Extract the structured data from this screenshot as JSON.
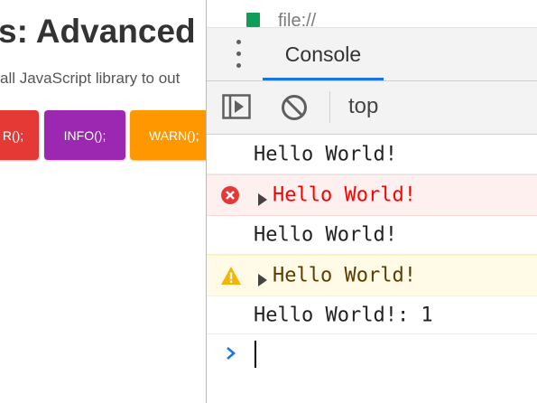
{
  "page": {
    "title": "s: Advanced C",
    "subtitle": "all JavaScript library to out",
    "buttons": {
      "error_label": "R();",
      "info_label": "INFO();",
      "warn_label": "WARN();"
    }
  },
  "devtools": {
    "url_text": "file://",
    "tabs": [
      {
        "label": "Console",
        "active": true
      }
    ],
    "toolbar": {
      "context": "top"
    },
    "messages": [
      {
        "level": "log",
        "text": "Hello World!"
      },
      {
        "level": "error",
        "text": "Hello World!"
      },
      {
        "level": "log",
        "text": "Hello World!"
      },
      {
        "level": "warning",
        "text": "Hello World!"
      },
      {
        "level": "log",
        "text": "Hello World!: 1"
      }
    ],
    "icons": {
      "menu": "kebab-menu-icon",
      "sidebar": "sidebar-toggle-icon",
      "clear": "clear-console-icon",
      "error": "error-icon",
      "warning": "warning-icon",
      "expand": "expand-triangle-icon",
      "prompt": "prompt-chevron-icon"
    }
  },
  "colors": {
    "error_button": "#e53935",
    "info_button": "#9c27b0",
    "warn_button": "#ff9800",
    "accent": "#1a73e8",
    "error_text": "#ff0000",
    "error_bg": "#fff0f0",
    "warning_bg": "#fffbe6",
    "warning_text": "#5c3c00"
  }
}
